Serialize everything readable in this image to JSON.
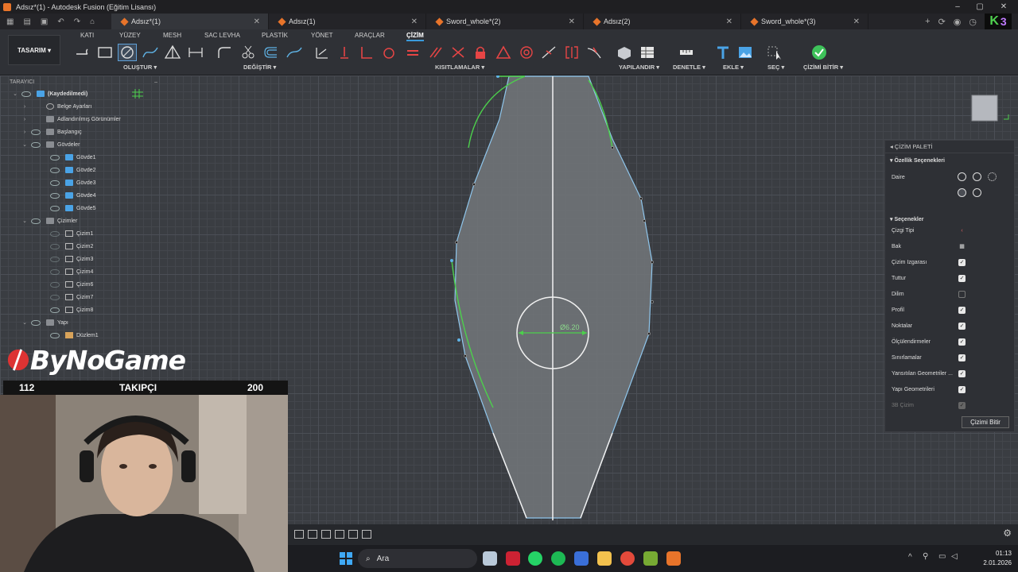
{
  "window": {
    "title": "Adsız*(1) - Autodesk Fusion (Eğitim Lisansı)"
  },
  "tabs": [
    {
      "label": "Adsız*(1)",
      "active": true
    },
    {
      "label": "Adsız(1)",
      "active": false
    },
    {
      "label": "Sword_whole*(2)",
      "active": false
    },
    {
      "label": "Adsız(2)",
      "active": false
    },
    {
      "label": "Sword_whole*(3)",
      "active": false
    }
  ],
  "ribbon": {
    "workspace": "TASARIM",
    "tabs": [
      "KATI",
      "YÜZEY",
      "MESH",
      "SAC LEVHA",
      "PLASTİK",
      "YÖNET",
      "ARAÇLAR",
      "ÇİZİM"
    ],
    "groups": {
      "create": "OLUŞTUR",
      "modify": "DEĞİŞTİR",
      "constraints": "KISITLAMALAR",
      "configure": "YAPILANDIR",
      "inspect": "DENETLE",
      "insert": "EKLE",
      "select": "SEÇ",
      "finish": "ÇİZİMİ BİTİR"
    }
  },
  "browser": {
    "title": "TARAYICI",
    "items": [
      {
        "label": "(Kaydedilmedi)",
        "level": 0
      },
      {
        "label": "Belge Ayarları",
        "level": 1
      },
      {
        "label": "Adlandırılmış Görünümler",
        "level": 1
      },
      {
        "label": "Başlangıç",
        "level": 1
      },
      {
        "label": "Gövdeler",
        "level": 1
      },
      {
        "label": "Gövde1",
        "level": 2
      },
      {
        "label": "Gövde2",
        "level": 2
      },
      {
        "label": "Gövde3",
        "level": 2
      },
      {
        "label": "Gövde4",
        "level": 2
      },
      {
        "label": "Gövde5",
        "level": 2
      },
      {
        "label": "Çizimler",
        "level": 1
      },
      {
        "label": "Çizim1",
        "level": 2
      },
      {
        "label": "Çizim2",
        "level": 2
      },
      {
        "label": "Çizim3",
        "level": 2
      },
      {
        "label": "Çizim4",
        "level": 2
      },
      {
        "label": "Çizim6",
        "level": 2
      },
      {
        "label": "Çizim7",
        "level": 2
      },
      {
        "label": "Çizim8",
        "level": 2
      },
      {
        "label": "Yapı",
        "level": 1
      },
      {
        "label": "Düzlem1",
        "level": 2
      }
    ]
  },
  "sketch": {
    "dimension": "Ø6.20"
  },
  "palette": {
    "title": "ÇİZİM PALETİ",
    "feature_options": "Özellik Seçenekleri",
    "circle_label": "Daire",
    "options_title": "Seçenekler",
    "options": [
      {
        "label": "Çizgi Tipi",
        "checked": null
      },
      {
        "label": "Bak",
        "checked": null
      },
      {
        "label": "Çizim Izgarası",
        "checked": true
      },
      {
        "label": "Tuttur",
        "checked": true
      },
      {
        "label": "Dilim",
        "checked": false
      },
      {
        "label": "Profil",
        "checked": true
      },
      {
        "label": "Noktalar",
        "checked": true
      },
      {
        "label": "Ölçülendirmeler",
        "checked": true
      },
      {
        "label": "Sınırlamalar",
        "checked": true
      },
      {
        "label": "Yansıtılan Geometriler ...",
        "checked": true
      },
      {
        "label": "Yapı Geometrileri",
        "checked": true
      },
      {
        "label": "3B Çizim",
        "checked": true
      }
    ],
    "finish_button": "Çizimi Bitir"
  },
  "overlay": {
    "logo": "ByNoGame",
    "followers_current": "112",
    "followers_label": "TAKIPÇI",
    "followers_goal": "200"
  },
  "taskbar": {
    "search_placeholder": "Ara",
    "time": "01:13",
    "date": "2.01.2026"
  },
  "colors": {
    "accent": "#3a9bdc",
    "sketch_green": "#4cd04c",
    "sketch_blue": "#5fb3e6",
    "brand": "#e8742a"
  }
}
